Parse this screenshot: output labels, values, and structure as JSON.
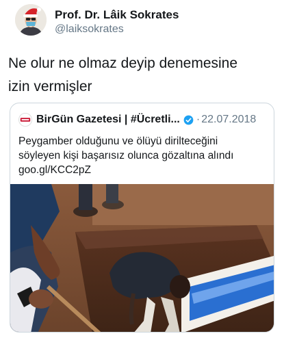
{
  "author": {
    "display_name": "Prof. Dr. Lâik Sokrates",
    "handle": "@laiksokrates"
  },
  "tweet": {
    "lines": [
      "Ne olur ne olmaz deyip denemesine",
      "izin vermişler"
    ]
  },
  "quoted": {
    "source_name": "BirGün Gazetesi | #Ücretli...",
    "separator": "·",
    "date": "22.07.2018",
    "lines": [
      "Peygamber olduğunu ve ölüyü dirilteceğini",
      "söyleyen kişi başarısız olunca gözaltına alındı",
      "goo.gl/KCC2pZ"
    ],
    "logo_text": "BirGün"
  },
  "icons": {
    "avatar": "santa-hat-avatar-icon",
    "verified": "verified-badge-icon",
    "source_logo": "birgun-logo-icon"
  },
  "colors": {
    "text": "#14171a",
    "muted": "#657786",
    "border": "#ccd6dd",
    "verified": "#1da1f2"
  }
}
